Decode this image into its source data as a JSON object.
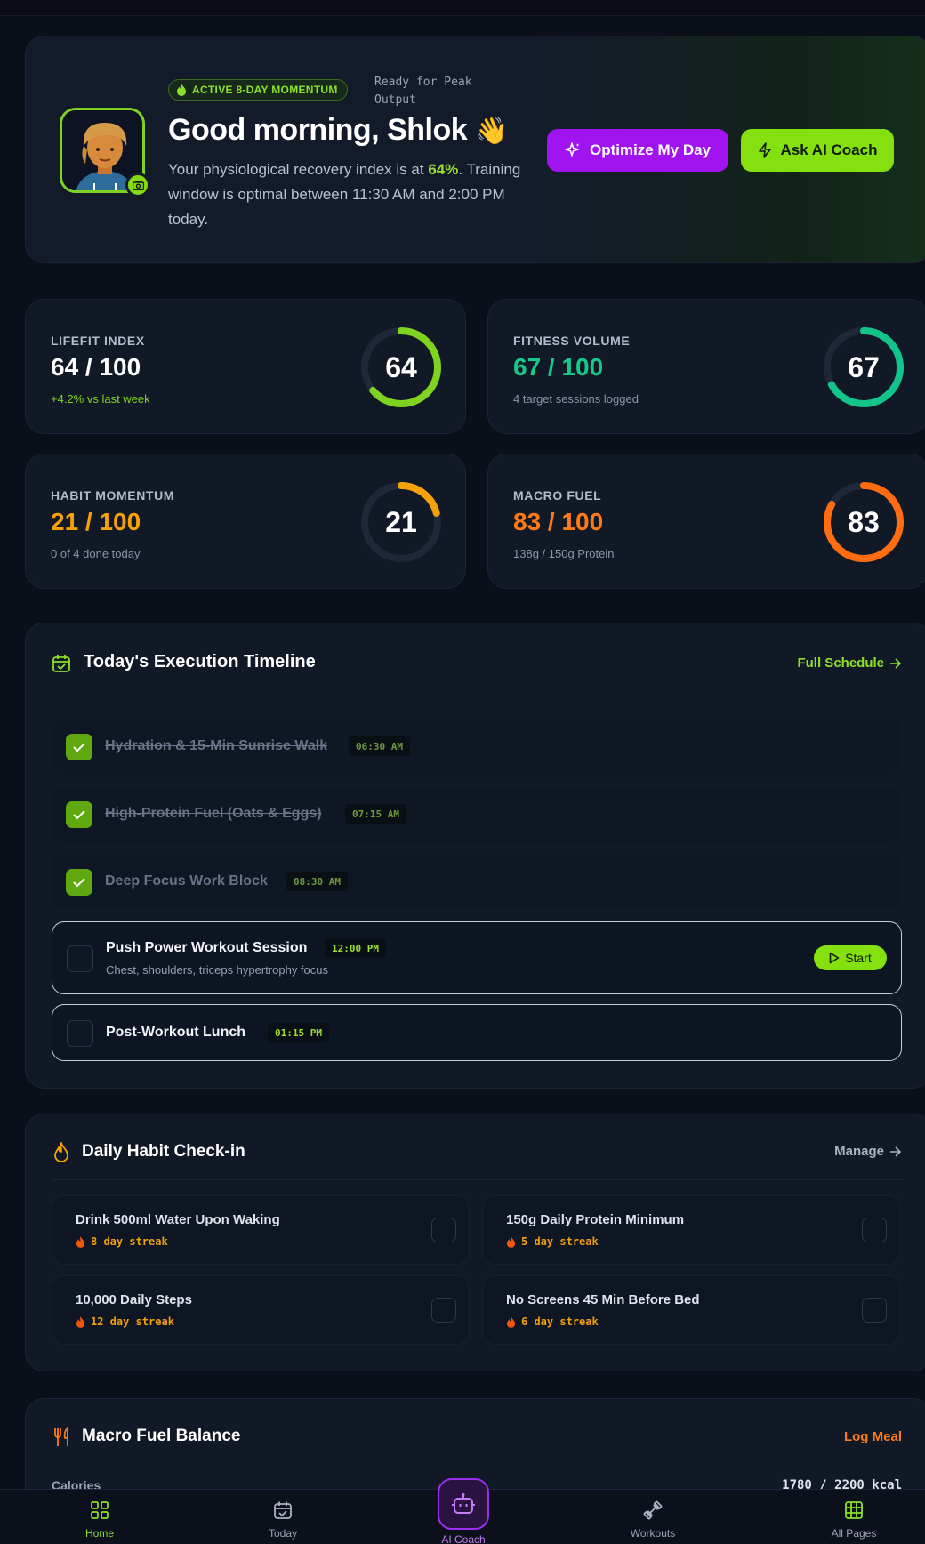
{
  "hero": {
    "badge": "ACTIVE 8-DAY MOMENTUM",
    "ready": "Ready for Peak Output",
    "greeting": "Good morning, Shlok",
    "wave": "👋",
    "desc_part1": "Your physiological recovery index is at ",
    "desc_highlight": "64%",
    "desc_part2": ". Training window is optimal between 11:30 AM and 2:00 PM today.",
    "optimize_label": "Optimize My Day",
    "coach_label": "Ask AI Coach",
    "accent_green": "#84e00f",
    "accent_purple": "#a114f0"
  },
  "stats": [
    {
      "label": "LIFEFIT INDEX",
      "value_text": "64 / 100",
      "sub": "+4.2% vs last week",
      "score": 64,
      "max": 100,
      "value_color": "#ffffff",
      "sub_color": "#7ed321",
      "ring_color": "#7ed321"
    },
    {
      "label": "FITNESS VOLUME",
      "value_text": "67 / 100",
      "sub": "4 target sessions logged",
      "score": 67,
      "max": 100,
      "value_color": "#15c98a",
      "sub_color": "#8c96a8",
      "ring_color": "#13c48a"
    },
    {
      "label": "HABIT MOMENTUM",
      "value_text": "21 / 100",
      "sub": "0 of 4 done today",
      "score": 21,
      "max": 100,
      "value_color": "#f5a20a",
      "sub_color": "#8c96a8",
      "ring_color": "#f5a20a"
    },
    {
      "label": "MACRO FUEL",
      "value_text": "83 / 100",
      "sub": "138g / 150g Protein",
      "score": 83,
      "max": 100,
      "value_color": "#ff7a14",
      "sub_color": "#8c96a8",
      "ring_color": "#ff6d10"
    }
  ],
  "timeline": {
    "title": "Today's Execution Timeline",
    "link": "Full Schedule",
    "items": [
      {
        "name": "Hydration & 15-Min Sunrise Walk",
        "time": "06:30 AM",
        "done": true
      },
      {
        "name": "High-Protein Fuel (Oats & Eggs)",
        "time": "07:15 AM",
        "done": true
      },
      {
        "name": "Deep Focus Work Block",
        "time": "08:30 AM",
        "done": true
      },
      {
        "name": "Push Power Workout Session",
        "time": "12:00 PM",
        "done": false,
        "sub": "Chest, shoulders, triceps hypertrophy focus",
        "action": "Start"
      },
      {
        "name": "Post-Workout Lunch",
        "time": "01:15 PM",
        "done": false
      }
    ]
  },
  "habits": {
    "title": "Daily Habit Check-in",
    "link": "Manage",
    "items": [
      {
        "name": "Drink 500ml Water Upon Waking",
        "streak": "8 day streak"
      },
      {
        "name": "150g Daily Protein Minimum",
        "streak": "5 day streak"
      },
      {
        "name": "10,000 Daily Steps",
        "streak": "12 day streak"
      },
      {
        "name": "No Screens 45 Min Before Bed",
        "streak": "6 day streak"
      }
    ]
  },
  "macro": {
    "title": "Macro Fuel Balance",
    "link": "Log Meal",
    "row_label": "Calories",
    "row_value": "1780 / 2200 kcal"
  },
  "nav": {
    "home": "Home",
    "today": "Today",
    "ai": "AI Coach",
    "workouts": "Workouts",
    "all": "All Pages"
  }
}
